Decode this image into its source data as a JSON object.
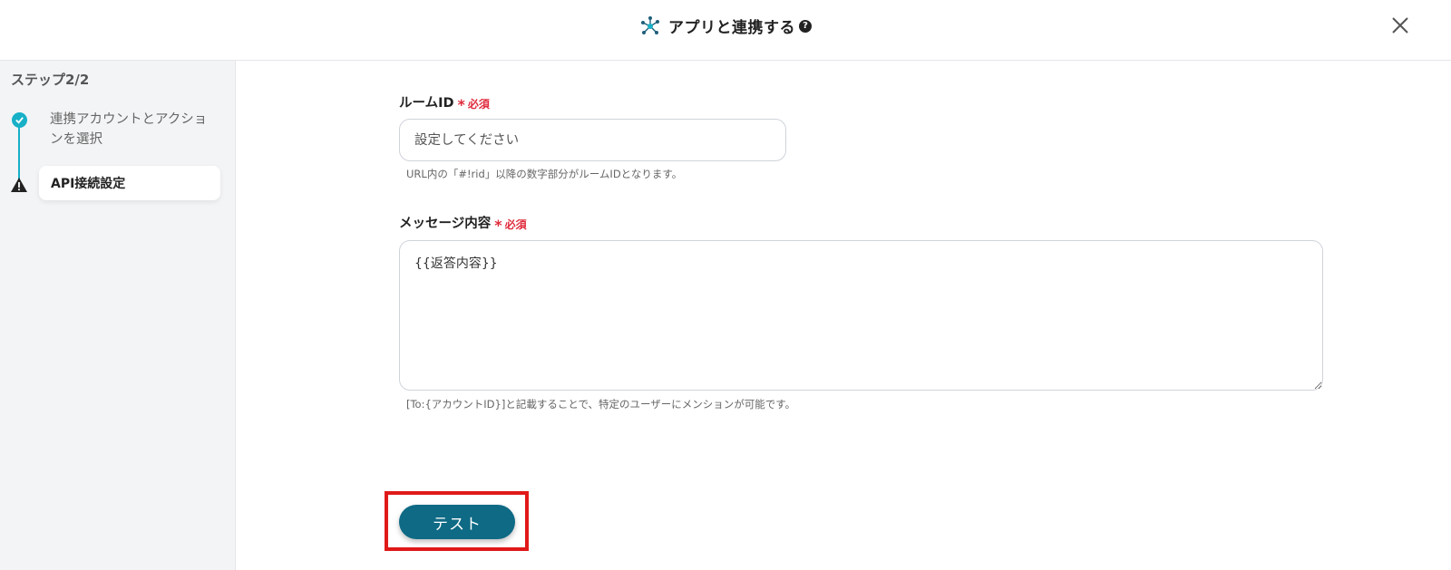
{
  "header": {
    "title": "アプリと連携する",
    "help_glyph": "?"
  },
  "sidebar": {
    "step_label": "ステップ2/2",
    "steps": [
      {
        "label": "連携アカウントとアクションを選択",
        "status": "completed"
      },
      {
        "label": "API接続設定",
        "status": "warning"
      }
    ]
  },
  "form": {
    "room_id": {
      "label": "ルームID",
      "required_star": "*",
      "required_text": "必須",
      "placeholder": "設定してください",
      "value": "",
      "hint": "URL内の「#!rid」以降の数字部分がルームIDとなります。"
    },
    "message": {
      "label": "メッセージ内容",
      "required_star": "*",
      "required_text": "必須",
      "value": "{{返答内容}}",
      "hint": "[To:{アカウントID}]と記載することで、特定のユーザーにメンションが可能です。"
    },
    "test_button": "テスト"
  },
  "colors": {
    "accent": "#17b0c7",
    "button": "#0e6a85",
    "required": "#e02b3c",
    "highlight": "#e01919"
  }
}
